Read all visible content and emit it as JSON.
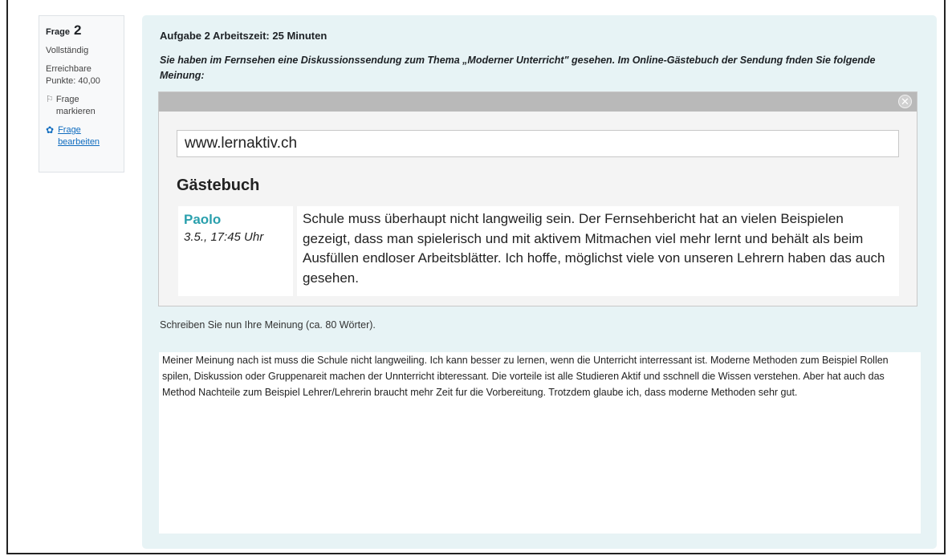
{
  "question_info": {
    "label": "Frage",
    "number": "2",
    "state": "Vollständig",
    "grade": "Erreichbare Punkte: 40,00",
    "flag_label": "Frage markieren",
    "edit_label": "Frage bearbeiten",
    "flag_icon": "flag-icon",
    "edit_icon": "gear-icon"
  },
  "task": {
    "title": "Aufgabe 2 Arbeitszeit: 25 Minuten",
    "intro": "Sie haben im Fernsehen eine Diskussionssendung zum Thema „Moderner Unterricht\" gesehen. Im Online-Gästebuch der Sendung fnden Sie folgende Meinung:"
  },
  "guestbook": {
    "url": "www.lernaktiv.ch",
    "title": "Gästebuch",
    "close_icon": "close-icon",
    "entry": {
      "author": "Paolo",
      "time": "3.5., 17:45 Uhr",
      "text": "Schule muss überhaupt nicht langweilig sein. Der Fernsehbericht hat an vielen Beispielen gezeigt, dass man spielerisch und mit aktivem Mitmachen viel mehr lernt und behält als beim Ausfüllen endloser Arbeitsblätter. Ich hoffe, möglichst viele von unseren Lehrern haben das auch gesehen."
    }
  },
  "prompt": "Schreiben Sie nun Ihre Meinung (ca. 80 Wörter).",
  "answer": " Meiner Meinung nach ist muss die Schule nicht langweiling. Ich kann besser zu lernen, wenn die Unterricht interressant ist. Moderne Methoden zum Beispiel Rollen spilen, Diskussion oder Gruppenareit machen der Unnterricht ibteressant. Die vorteile ist alle Studieren Aktif und sschnell die Wissen verstehen. Aber hat auch das Method Nachteile zum Beispiel Lehrer/Lehrerin braucht mehr Zeit fur die Vorbereitung. Trotzdem glaube ich, dass moderne Methoden sehr gut."
}
